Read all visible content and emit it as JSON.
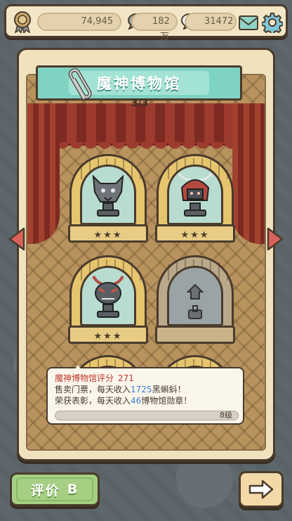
{
  "topbar": {
    "coins": "74,945",
    "resource2": "182万",
    "resource3": "31472",
    "icons": [
      "medal-icon",
      "speech-bubble-icon",
      "chat-bubble-icon",
      "mail-icon",
      "gear-icon"
    ]
  },
  "museum": {
    "title": "魔神博物馆",
    "page": "3/3",
    "exhibits": [
      {
        "name": "wolf-head-trophy",
        "stars": "★★★",
        "locked": false
      },
      {
        "name": "samurai-helmet-trophy",
        "stars": "★★★",
        "locked": false
      },
      {
        "name": "demon-mask-trophy",
        "stars": "★★★",
        "locked": false
      },
      {
        "name": "locked-exhibit",
        "stars": "",
        "locked": true
      }
    ]
  },
  "info": {
    "score_label": "魔神博物馆评分",
    "score": "271",
    "line2_pre": "售卖门票，每天收入",
    "line2_num": "1725",
    "line2_post": "黑蝌蚪！",
    "line3_pre": "荣获表彰，每天收入",
    "line3_num": "46",
    "line3_post": "博物馆勋章！",
    "level": "8级",
    "progress": 0.0
  },
  "buttons": {
    "rate_label": "评价",
    "rate_grade": "B"
  },
  "colors": {
    "accent_teal": "#7fd3c3",
    "frame_cream": "#efe2bd",
    "rate_green": "#a6cf84",
    "curtain_red": "#9c3b2e",
    "score_red": "#c0392b",
    "number_blue": "#3b7fd4"
  }
}
